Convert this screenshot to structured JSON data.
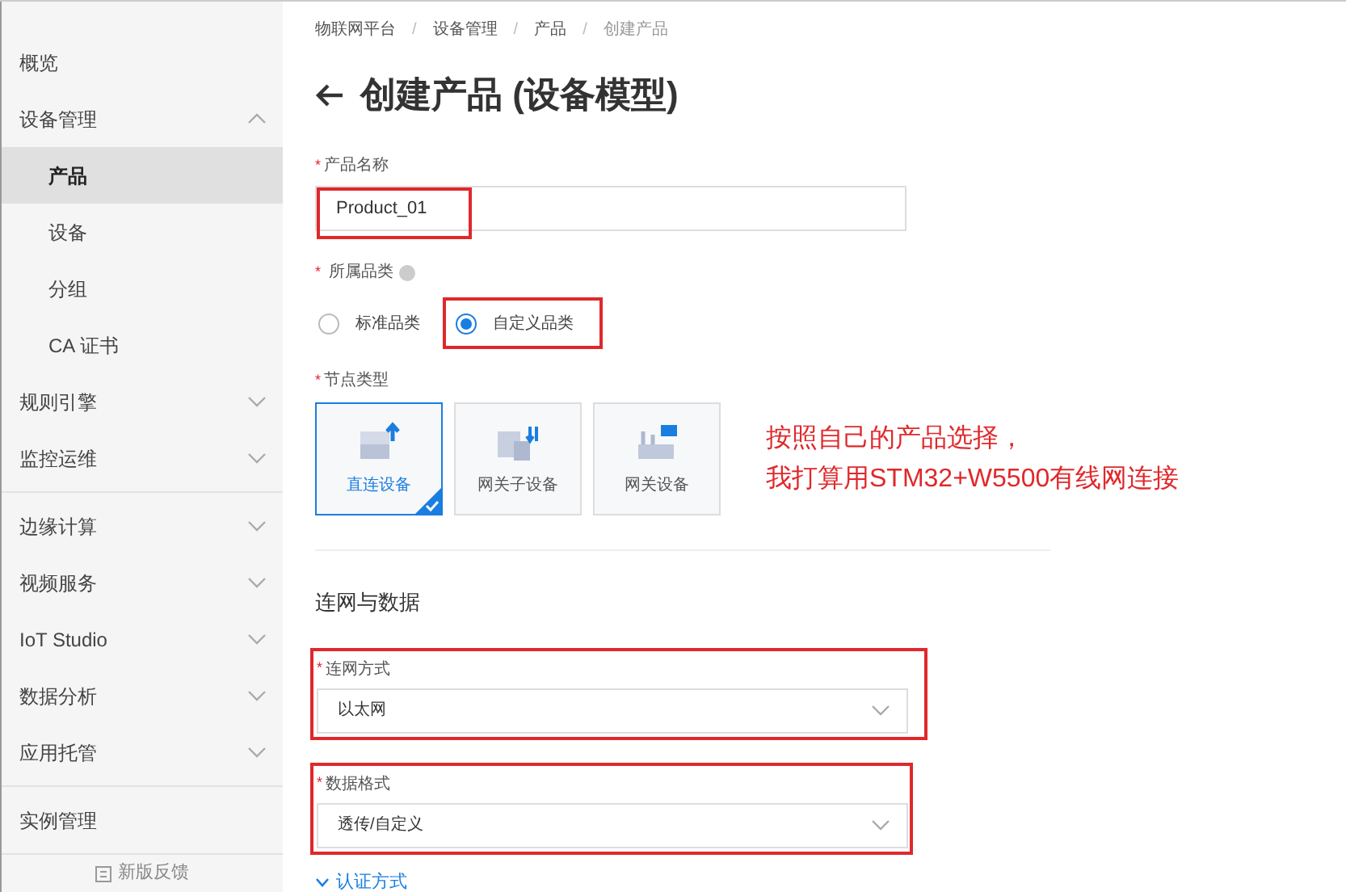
{
  "sidebar": {
    "groups": [
      {
        "items": [
          {
            "label": "概览",
            "kind": "link",
            "selected": false
          },
          {
            "label": "设备管理",
            "kind": "menu",
            "expanded": true,
            "selected": false,
            "children": [
              {
                "label": "产品",
                "kind": "link",
                "selected": true
              },
              {
                "label": "设备",
                "kind": "link",
                "selected": false
              },
              {
                "label": "分组",
                "kind": "link",
                "selected": false
              },
              {
                "label": "CA 证书",
                "kind": "link",
                "selected": false
              }
            ]
          },
          {
            "label": "规则引擎",
            "kind": "menu",
            "expanded": false,
            "selected": false
          },
          {
            "label": "监控运维",
            "kind": "menu",
            "expanded": false,
            "selected": false
          }
        ]
      },
      {
        "items": [
          {
            "label": "边缘计算",
            "kind": "menu",
            "expanded": false,
            "selected": false
          },
          {
            "label": "视频服务",
            "kind": "menu",
            "expanded": false,
            "selected": false
          },
          {
            "label": "IoT Studio",
            "kind": "menu",
            "expanded": false,
            "selected": false
          },
          {
            "label": "数据分析",
            "kind": "menu",
            "expanded": false,
            "selected": false
          },
          {
            "label": "应用托管",
            "kind": "menu",
            "expanded": false,
            "selected": false
          }
        ]
      },
      {
        "items": [
          {
            "label": "实例管理",
            "kind": "link",
            "selected": false
          }
        ]
      }
    ],
    "feedback": "新版反馈"
  },
  "breadcrumb": [
    "物联网平台",
    "/",
    "设备管理",
    "/",
    "产品",
    "/",
    "创建产品"
  ],
  "title": "创建产品 (设备模型)",
  "product_name": {
    "mark": "*",
    "label": "产品名称",
    "value": "Product_01",
    "annotated": true
  },
  "category": {
    "mark": "*",
    "label": "所属品类",
    "options": [
      {
        "label": "标准品类",
        "selected": false,
        "annotated": false
      },
      {
        "label": "自定义品类",
        "selected": true,
        "annotated": true
      }
    ]
  },
  "node_type": {
    "mark": "*",
    "label": "节点类型",
    "options": [
      {
        "label": "直连设备",
        "kind": "direct",
        "selected": true
      },
      {
        "label": "网关子设备",
        "kind": "subdevice",
        "selected": false
      },
      {
        "label": "网关设备",
        "kind": "gateway",
        "selected": false
      }
    ]
  },
  "annotation": [
    "按照自己的产品选择，",
    "我打算用STM32+W5500有线网连接"
  ],
  "section": "连网与数据",
  "selects": [
    {
      "mark": "*",
      "label": "连网方式",
      "value": "以太网",
      "annotated": true
    },
    {
      "mark": "*",
      "label": "数据格式",
      "value": "透传/自定义",
      "annotated": true
    }
  ],
  "auth_toggle": "认证方式"
}
